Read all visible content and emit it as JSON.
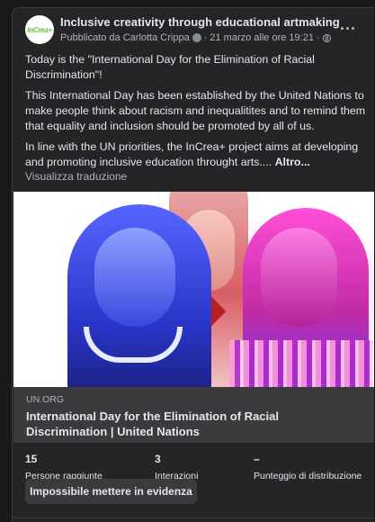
{
  "post": {
    "page_name": "Inclusive creativity through educational artmaking",
    "avatar_logo_text": "InCrea+",
    "published_by": "Pubblicato da Carlotta Crippa",
    "date": "21 marzo alle ore 19:21",
    "paragraphs": [
      "Today is the \"International Day for the Elimination of Racial Discrimination\"!",
      "This International Day has been established by the United Nations to make people think about racism and inequalitites and to remind them that equality and inclusion should be promoted by all of us.",
      "In line with the UN priorities, the InCrea+ project aims at developing and promoting inclusive education throught arts...."
    ],
    "see_more": "Altro...",
    "translate_label": "Visualizza traduzione"
  },
  "link": {
    "domain": "UN.ORG",
    "title": "International Day for the Elimination of Racial Discrimination | United Nations"
  },
  "stats": [
    {
      "value": "15",
      "label": "Persone raggiunte"
    },
    {
      "value": "3",
      "label": "Interazioni"
    },
    {
      "value": "–",
      "label": "Punteggio di distribuzione"
    }
  ],
  "boost_button": "Impossibile mettere in evidenza",
  "icons": {
    "more": "more-horizontal-icon",
    "audience": "globe-icon",
    "author": "author-badge-icon"
  },
  "colors": {
    "background": "#18191a",
    "card": "#242526",
    "secondary_text": "#b0b3b8",
    "link_box": "#3a3b3c"
  }
}
